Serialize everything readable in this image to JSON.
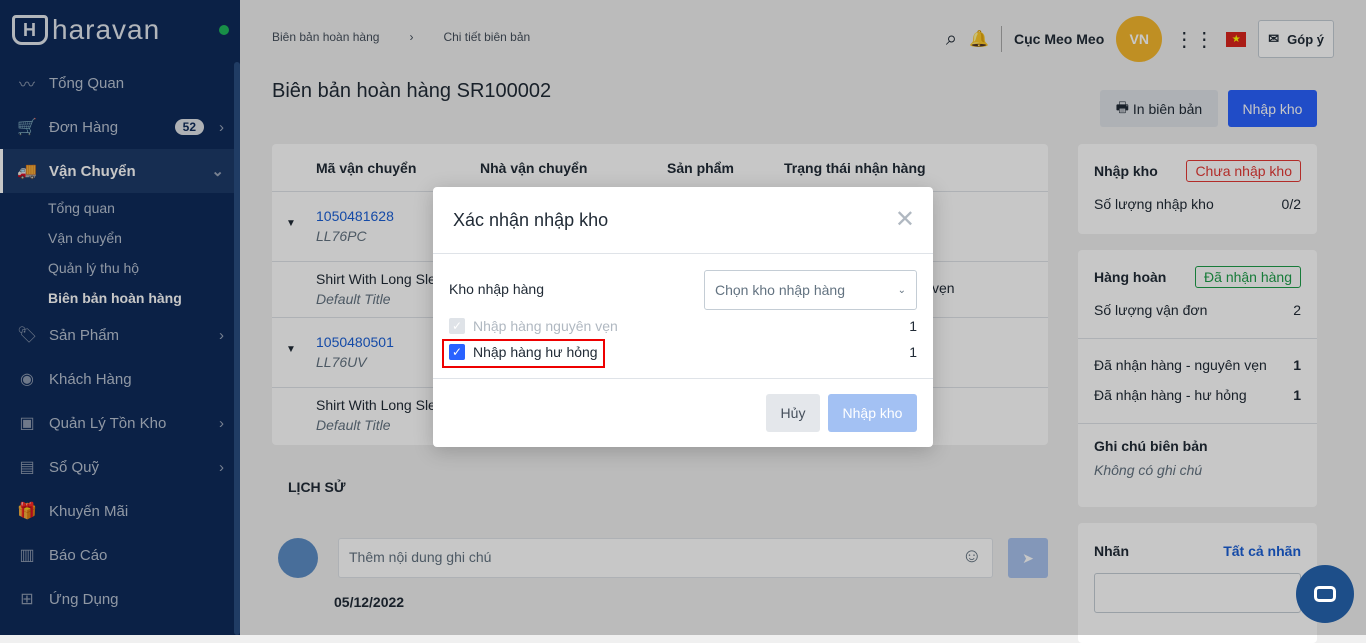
{
  "brand": "haravan",
  "sidebar": {
    "items": [
      {
        "label": "Tổng Quan",
        "icon": "chart-line-icon"
      },
      {
        "label": "Đơn Hàng",
        "icon": "cart-icon",
        "badge": "52"
      },
      {
        "label": "Vận Chuyển",
        "icon": "truck-icon"
      },
      {
        "label": "Sản Phẩm",
        "icon": "tag-icon"
      },
      {
        "label": "Khách Hàng",
        "icon": "user-icon"
      },
      {
        "label": "Quản Lý Tồn Kho",
        "icon": "inventory-icon"
      },
      {
        "label": "Sổ Quỹ",
        "icon": "cashbook-icon"
      },
      {
        "label": "Khuyến Mãi",
        "icon": "gift-icon"
      },
      {
        "label": "Báo Cáo",
        "icon": "report-icon"
      },
      {
        "label": "Ứng Dụng",
        "icon": "apps-icon"
      }
    ],
    "sub": [
      "Tổng quan",
      "Vận chuyển",
      "Quản lý thu hộ",
      "Biên bản hoàn hàng"
    ]
  },
  "breadcrumb": [
    "Biên bản hoàn hàng",
    "Chi tiết biên bản"
  ],
  "header": {
    "user": "Cục Meo Meo",
    "avatar": "VN",
    "feedback": "Góp ý"
  },
  "page": {
    "title": "Biên bản hoàn hàng SR100002",
    "print": "In biên bản",
    "import": "Nhập kho"
  },
  "table": {
    "headers": [
      "Mã vận chuyển",
      "Nhà vận chuyển",
      "Sản phẩm",
      "Trạng thái nhận hàng"
    ],
    "rows": [
      {
        "code": "1050481628",
        "sub": "LL76PC",
        "product": "Shirt With Long Sle",
        "variant": "Default Title",
        "status": "vẹn"
      },
      {
        "code": "1050480501",
        "sub": "LL76UV",
        "product": "Shirt With Long Sle",
        "variant": "Default Title"
      }
    ]
  },
  "history": {
    "title": "LỊCH SỬ",
    "placeholder": "Thêm nội dung ghi chú",
    "date": "05/12/2022"
  },
  "right": {
    "import_title": "Nhập kho",
    "import_status": "Chưa nhập kho",
    "import_qty_label": "Số lượng nhập kho",
    "import_qty": "0/2",
    "return_title": "Hàng hoàn",
    "return_status": "Đã nhận hàng",
    "waybill_label": "Số lượng vận đơn",
    "waybill": "2",
    "intact_label": "Đã nhận hàng - nguyên vẹn",
    "intact": "1",
    "damaged_label": "Đã nhận hàng - hư hỏng",
    "damaged": "1",
    "note_title": "Ghi chú biên bản",
    "note": "Không có ghi chú",
    "tag_title": "Nhãn",
    "tag_all": "Tất cả nhãn"
  },
  "modal": {
    "title": "Xác nhận nhập kho",
    "warehouse_label": "Kho nhập hàng",
    "warehouse_placeholder": "Chọn kho nhập hàng",
    "opt1": "Nhập hàng nguyên vẹn",
    "opt1_qty": "1",
    "opt2": "Nhập hàng hư hỏng",
    "opt2_qty": "1",
    "cancel": "Hủy",
    "confirm": "Nhập kho"
  }
}
